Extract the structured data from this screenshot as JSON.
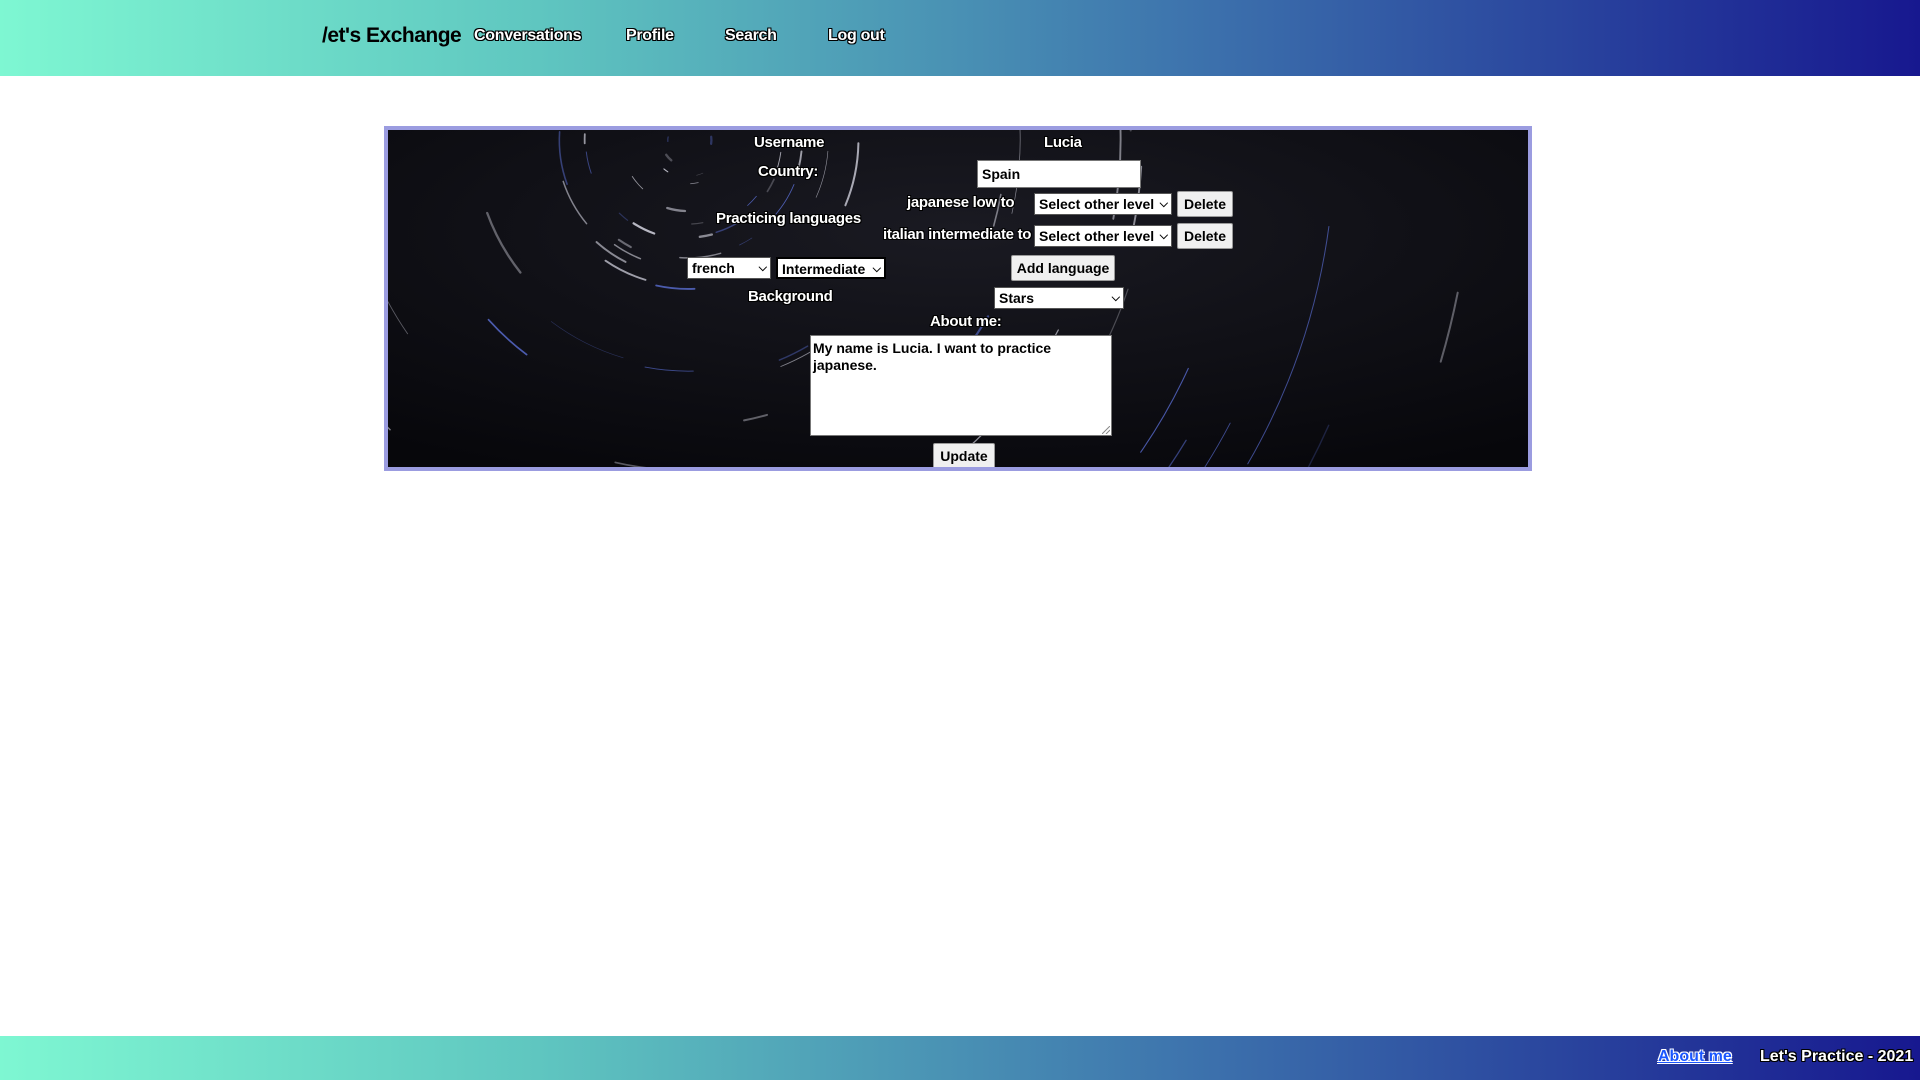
{
  "header": {
    "brand": "/et's Exchange",
    "nav": [
      {
        "label": "Conversations"
      },
      {
        "label": "Profile"
      },
      {
        "label": "Search"
      },
      {
        "label": "Log out"
      }
    ]
  },
  "profile": {
    "username_label": "Username",
    "username_value": "Lucia",
    "country_label": "Country:",
    "country_value": "Spain",
    "practicing_label": "Practicing languages",
    "languages": [
      {
        "text": "japanese low to",
        "select": "Select other level",
        "delete": "Delete"
      },
      {
        "text": "italian intermediate to",
        "select": "Select other level",
        "delete": "Delete"
      }
    ],
    "new_language": {
      "language": "french",
      "level": "Intermediate",
      "add_label": "Add language"
    },
    "background_label": "Background",
    "background_value": "Stars",
    "about_label": "About me:",
    "about_text": "My name is Lucia. I want to practice japanese.",
    "update_label": "Update"
  },
  "footer": {
    "about_link": "About me",
    "copyright": "Let's Practice - 2021"
  },
  "colors": {
    "header_gradient_start": "#7ef7d2",
    "header_gradient_end": "#17188f",
    "panel_border": "#9b9ce0",
    "footer_link": "#1a56ff"
  },
  "icons": {
    "select_arrow": "chevron-down-icon",
    "resize_handle": "resize-grip-icon"
  }
}
